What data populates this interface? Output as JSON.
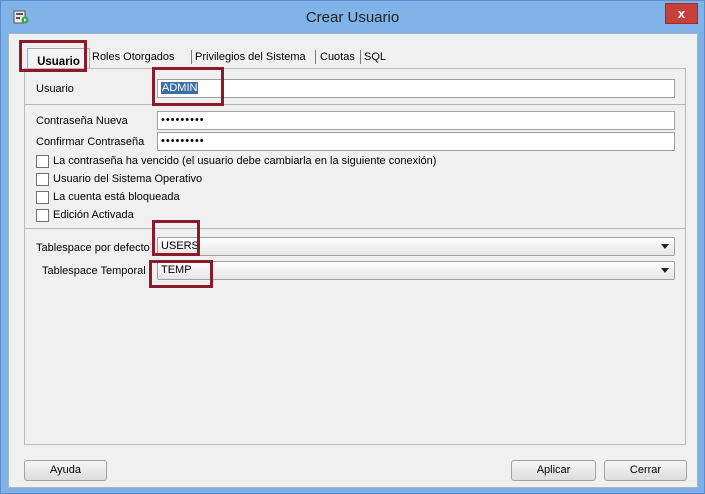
{
  "window": {
    "title": "Crear Usuario",
    "close_glyph": "x"
  },
  "tabs": [
    {
      "label": "Usuario",
      "active": true
    },
    {
      "label": "Roles Otorgados"
    },
    {
      "label": "Privilegios del Sistema"
    },
    {
      "label": "Cuotas"
    },
    {
      "label": "SQL"
    }
  ],
  "form": {
    "usuario_label": "Usuario",
    "usuario_value": "ADMIN",
    "password_label": "Contraseña Nueva",
    "password_value": "•••••••••",
    "confirm_label": "Confirmar Contraseña",
    "confirm_value": "•••••••••",
    "checkboxes": [
      {
        "label": "La contraseña ha vencido (el usuario debe cambiarla en la siguiente conexión)",
        "checked": false
      },
      {
        "label": "Usuario del Sistema Operativo",
        "checked": false
      },
      {
        "label": "La cuenta está bloqueada",
        "checked": false
      },
      {
        "label": "Edición Activada",
        "checked": false
      }
    ],
    "tablespace_default_label": "Tablespace por defecto",
    "tablespace_default_value": "USERS",
    "tablespace_temp_label": "Tablespace Temporal",
    "tablespace_temp_value": "TEMP"
  },
  "buttons": {
    "help": "Ayuda",
    "apply": "Aplicar",
    "close": "Cerrar"
  },
  "colors": {
    "highlight_box": "#8b1a2b",
    "title_bar": "#80b3e8",
    "close_button": "#c7413a"
  }
}
